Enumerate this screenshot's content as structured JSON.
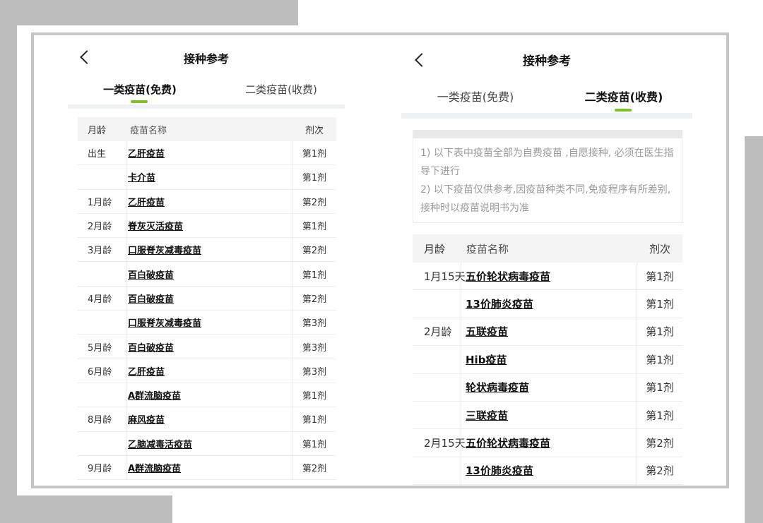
{
  "left": {
    "title": "接种参考",
    "tabs": [
      {
        "label": "一类疫苗(免费)",
        "active": true
      },
      {
        "label": "二类疫苗(收费)",
        "active": false
      }
    ],
    "headers": {
      "age": "月龄",
      "name": "疫苗名称",
      "dose": "剂次"
    },
    "rows": [
      {
        "age": "出生",
        "name": "乙肝疫苗",
        "dose": "第1剂"
      },
      {
        "age": "",
        "name": "卡介苗",
        "dose": "第1剂"
      },
      {
        "age": "1月龄",
        "name": "乙肝疫苗",
        "dose": "第2剂"
      },
      {
        "age": "2月龄",
        "name": "脊灰灭活疫苗",
        "dose": "第1剂"
      },
      {
        "age": "3月龄",
        "name": "口服脊灰减毒疫苗",
        "dose": "第2剂"
      },
      {
        "age": "",
        "name": "百白破疫苗",
        "dose": "第1剂"
      },
      {
        "age": "4月龄",
        "name": "百白破疫苗",
        "dose": "第2剂"
      },
      {
        "age": "",
        "name": "口服脊灰减毒疫苗",
        "dose": "第3剂"
      },
      {
        "age": "5月龄",
        "name": "百白破疫苗",
        "dose": "第3剂"
      },
      {
        "age": "6月龄",
        "name": "乙肝疫苗",
        "dose": "第3剂"
      },
      {
        "age": "",
        "name": "A群流脑疫苗",
        "dose": "第1剂"
      },
      {
        "age": "8月龄",
        "name": "麻风疫苗",
        "dose": "第1剂"
      },
      {
        "age": "",
        "name": "乙脑减毒活疫苗",
        "dose": "第1剂"
      },
      {
        "age": "9月龄",
        "name": "A群流脑疫苗",
        "dose": "第2剂"
      }
    ]
  },
  "right": {
    "title": "接种参考",
    "tabs": [
      {
        "label": "一类疫苗(免费)",
        "active": false
      },
      {
        "label": "二类疫苗(收费)",
        "active": true
      }
    ],
    "notice": [
      "1) 以下表中疫苗全部为自费疫苗 ,自愿接种, 必须在医生指导下进行",
      "2) 以下疫苗仅供参考,因疫苗种类不同,免疫程序有所差别,接种时以疫苗说明书为准"
    ],
    "headers": {
      "age": "月龄",
      "name": "疫苗名称",
      "dose": "剂次"
    },
    "rows": [
      {
        "age": "1月15天",
        "name": "五价轮状病毒疫苗",
        "dose": "第1剂"
      },
      {
        "age": "",
        "name": "13价肺炎疫苗",
        "dose": "第1剂"
      },
      {
        "age": "2月龄",
        "name": "五联疫苗",
        "dose": "第1剂"
      },
      {
        "age": "",
        "name": "Hib疫苗",
        "dose": "第1剂"
      },
      {
        "age": "",
        "name": "轮状病毒疫苗",
        "dose": "第1剂"
      },
      {
        "age": "",
        "name": "三联疫苗",
        "dose": "第1剂"
      },
      {
        "age": "2月15天",
        "name": "五价轮状病毒疫苗",
        "dose": "第2剂"
      },
      {
        "age": "",
        "name": "13价肺炎疫苗",
        "dose": "第2剂"
      }
    ]
  },
  "colors": {
    "accent": "#7cc225",
    "border_gray": "#c5c5c5",
    "deco_gray": "#bdbdbd",
    "header_bg": "#f4f4f4",
    "notice_text": "#9a9a9a"
  }
}
